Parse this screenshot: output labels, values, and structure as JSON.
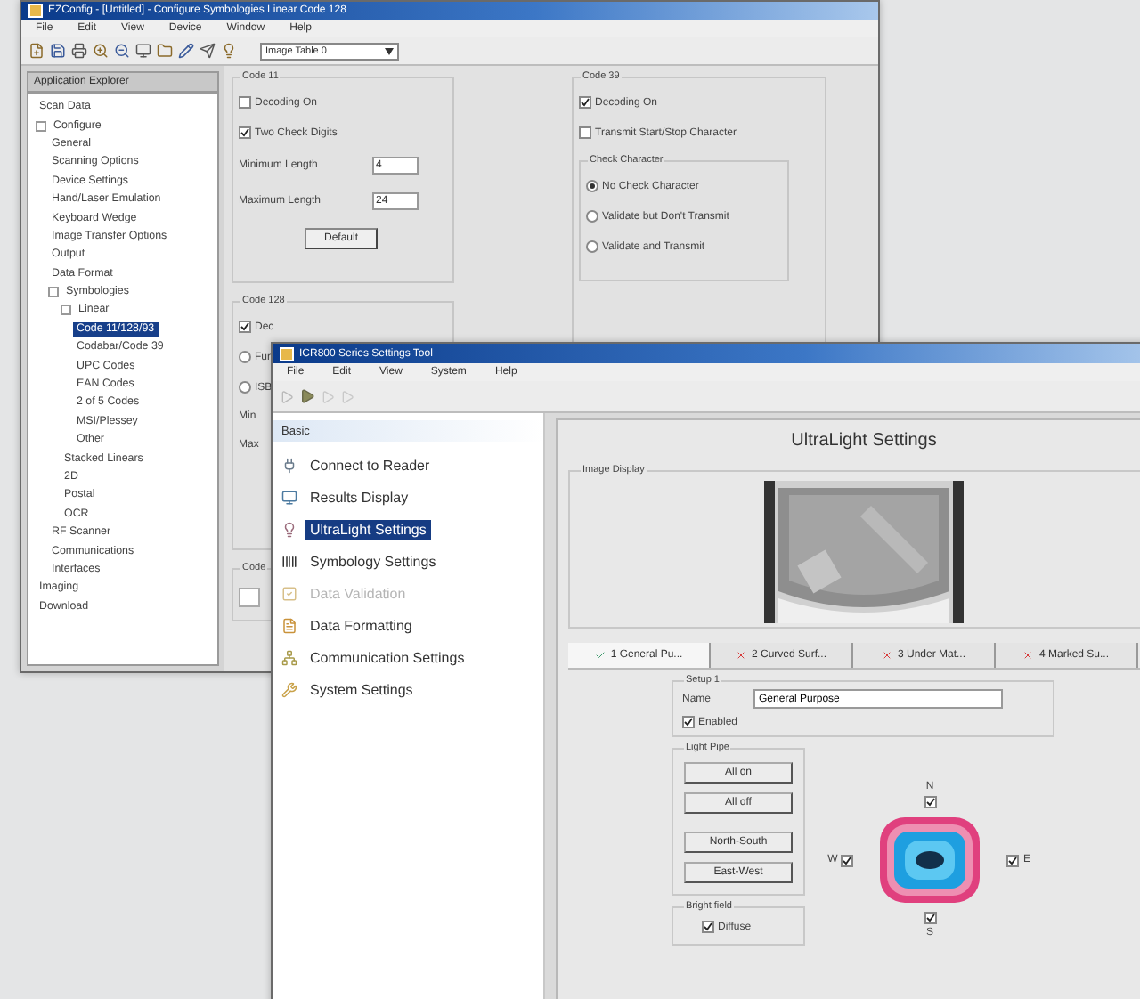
{
  "back_window": {
    "title": "EZConfig - [Untitled] - Configure Symbologies Linear Code 128",
    "menu": [
      "File",
      "Edit",
      "View",
      "Device",
      "Window",
      "Help"
    ],
    "dropdown": "Image Table 0",
    "explorer": {
      "title": "Application Explorer",
      "tree": [
        {
          "label": "Scan Data",
          "selected": false
        },
        {
          "label": "Configure",
          "selected": false,
          "children": [
            {
              "label": "General",
              "selected": false
            },
            {
              "label": "Scanning Options",
              "selected": false
            },
            {
              "label": "Device Settings",
              "selected": false
            },
            {
              "label": "Hand/Laser Emulation",
              "selected": false
            },
            {
              "label": "Keyboard Wedge",
              "selected": false
            },
            {
              "label": "Image Transfer Options",
              "selected": false
            },
            {
              "label": "Output",
              "selected": false
            },
            {
              "label": "Data Format",
              "selected": false
            },
            {
              "label": "Symbologies",
              "selected": false,
              "children": [
                {
                  "label": "Linear",
                  "selected": false,
                  "children": [
                    {
                      "label": "Code 11/128/93",
                      "selected": true
                    },
                    {
                      "label": "Codabar/Code 39",
                      "selected": false
                    },
                    {
                      "label": "UPC Codes",
                      "selected": false
                    },
                    {
                      "label": "EAN Codes",
                      "selected": false
                    },
                    {
                      "label": "2 of 5 Codes",
                      "selected": false
                    },
                    {
                      "label": "MSI/Plessey",
                      "selected": false
                    },
                    {
                      "label": "Other",
                      "selected": false
                    }
                  ]
                },
                {
                  "label": "Stacked Linears",
                  "selected": false
                },
                {
                  "label": "2D",
                  "selected": false
                },
                {
                  "label": "Postal",
                  "selected": false
                },
                {
                  "label": "OCR",
                  "selected": false
                }
              ]
            },
            {
              "label": "RF Scanner",
              "selected": false
            },
            {
              "label": "Communications",
              "selected": false
            },
            {
              "label": "Interfaces",
              "selected": false
            }
          ]
        },
        {
          "label": "Imaging",
          "selected": false
        },
        {
          "label": "Download",
          "selected": false
        }
      ]
    },
    "code11": {
      "title": "Code 11",
      "options": [
        {
          "label": "Decoding On",
          "checked": false
        },
        {
          "label": "Two Check Digits",
          "checked": true
        }
      ],
      "fields": [
        {
          "label": "Minimum Length",
          "value": "4"
        },
        {
          "label": "Maximum Length",
          "value": "24"
        }
      ],
      "button": "Default"
    },
    "code128": {
      "title": "Code 128",
      "options": [
        {
          "label": "Dec",
          "kind": "checkbox",
          "checked": true
        },
        {
          "label": "Fun",
          "kind": "radio",
          "checked": false
        },
        {
          "label": "ISB",
          "kind": "radio",
          "checked": false
        }
      ],
      "labels": [
        "Min",
        "Max"
      ]
    },
    "code93": {
      "title": "Code"
    },
    "code39": {
      "title": "Code 39",
      "options": [
        {
          "label": "Decoding On",
          "checked": true
        },
        {
          "label": "Transmit Start/Stop Character",
          "checked": false
        }
      ],
      "check_character": {
        "title": "Check Character",
        "options": [
          {
            "label": "No Check Character",
            "selected": true
          },
          {
            "label": "Validate but Don't Transmit",
            "selected": false
          },
          {
            "label": "Validate and Transmit",
            "selected": false
          }
        ]
      }
    }
  },
  "front_window": {
    "title": "ICR800 Series Settings Tool",
    "menu": [
      "File",
      "Edit",
      "View",
      "System",
      "Help"
    ],
    "sidebar": {
      "header": "Basic",
      "items": [
        {
          "label": "Connect to Reader",
          "selected": false,
          "disabled": false
        },
        {
          "label": "Results Display",
          "selected": false,
          "disabled": false
        },
        {
          "label": "UltraLight Settings",
          "selected": true,
          "disabled": false
        },
        {
          "label": "Symbology Settings",
          "selected": false,
          "disabled": false
        },
        {
          "label": "Data Validation",
          "selected": false,
          "disabled": true
        },
        {
          "label": "Data Formatting",
          "selected": false,
          "disabled": false
        },
        {
          "label": "Communication Settings",
          "selected": false,
          "disabled": false
        },
        {
          "label": "System Settings",
          "selected": false,
          "disabled": false
        }
      ]
    },
    "panel": {
      "title": "UltraLight Settings",
      "image_display": {
        "title": "Image Display"
      },
      "tabs": [
        {
          "label": "1 General Pu...",
          "kind": "ok",
          "selected": true
        },
        {
          "label": "2 Curved Surf...",
          "kind": "error",
          "selected": false
        },
        {
          "label": "3 Under Mat...",
          "kind": "error",
          "selected": false
        },
        {
          "label": "4 Marked Su...",
          "kind": "error",
          "selected": false
        }
      ],
      "setup": {
        "title": "Setup 1",
        "name_label": "Name",
        "name_value": "General Purpose",
        "enabled": {
          "label": "Enabled",
          "checked": true
        }
      },
      "light_pipe": {
        "title": "Light Pipe",
        "buttons": [
          "All on",
          "All off",
          "North-South",
          "East-West"
        ]
      },
      "bright_field": {
        "title": "Bright field",
        "diffuse": {
          "label": "Diffuse",
          "checked": true
        }
      },
      "directions": [
        {
          "kind": "north",
          "label": "N",
          "checked": true
        },
        {
          "kind": "west",
          "label": "W",
          "checked": true
        },
        {
          "kind": "east",
          "label": "E",
          "checked": true
        },
        {
          "kind": "south",
          "label": "S",
          "checked": true
        }
      ]
    }
  }
}
